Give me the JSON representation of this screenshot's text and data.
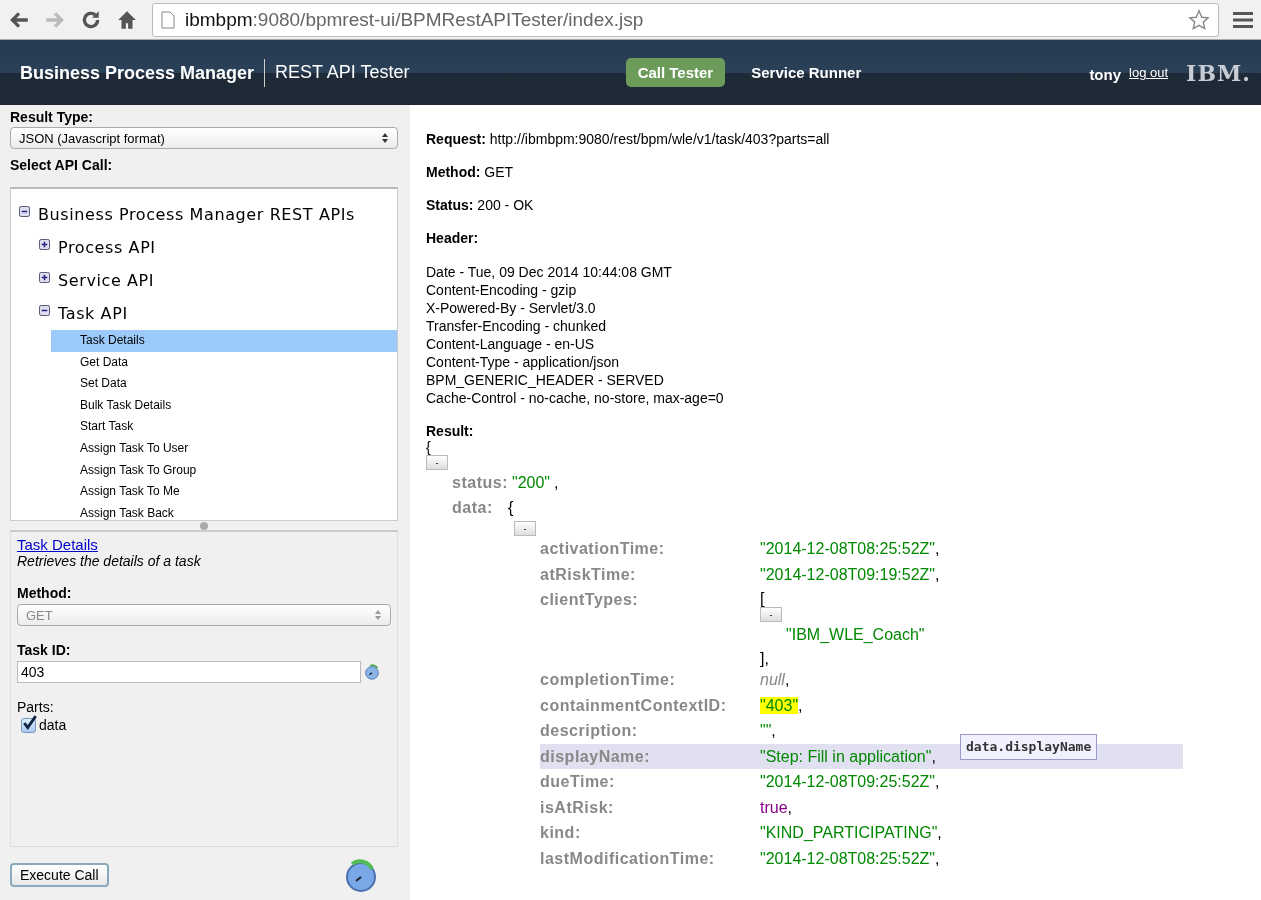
{
  "browser": {
    "url_host": "ibmbpm",
    "url_rest": ":9080/bpmrest-ui/BPMRestAPITester/index.jsp",
    "forward_disabled": true
  },
  "header": {
    "product": "Business Process Manager",
    "app": "REST API Tester",
    "nav": [
      {
        "label": "Call Tester",
        "selected": true
      },
      {
        "label": "Service Runner",
        "selected": false
      }
    ],
    "user": "tony",
    "logout": "log out",
    "logo": "IBM."
  },
  "left": {
    "result_type_label": "Result Type:",
    "result_type": "JSON (Javascript format)",
    "select_label": "Select API Call:",
    "tree": [
      {
        "label": "Business Process Manager REST APIs",
        "expanded": true,
        "children": [
          {
            "label": "Process API",
            "expanded": false
          },
          {
            "label": "Service API",
            "expanded": false
          },
          {
            "label": "Task API",
            "expanded": true,
            "children": [
              {
                "label": "Task Details",
                "selected": true
              },
              {
                "label": "Get Data",
                "selected": false
              },
              {
                "label": "Set Data",
                "selected": false
              },
              {
                "label": "Bulk Task Details",
                "selected": false
              },
              {
                "label": "Start Task",
                "selected": false
              },
              {
                "label": "Assign Task To User",
                "selected": false
              },
              {
                "label": "Assign Task To Group",
                "selected": false
              },
              {
                "label": "Assign Task To Me",
                "selected": false
              },
              {
                "label": "Assign Task Back",
                "selected": false
              }
            ]
          }
        ]
      }
    ],
    "detail": {
      "link": "Task Details",
      "description": "Retrieves the details of a task",
      "method_label": "Method:",
      "method": "GET",
      "method_disabled": true,
      "task_id_label": "Task ID:",
      "task_id": "403",
      "parts_label": "Parts:",
      "parts": [
        {
          "label": "data",
          "checked": true
        }
      ]
    },
    "execute": "Execute Call"
  },
  "response": {
    "fields": [
      {
        "label": "Request:",
        "value": "http://ibmbpm:9080/rest/bpm/wle/v1/task/403?parts=all"
      },
      {
        "label": "Method:",
        "value": "GET"
      },
      {
        "label": "Status:",
        "value": "200 - OK"
      }
    ],
    "header_label": "Header:",
    "headers": [
      "Date - Tue, 09 Dec 2014 10:44:08 GMT",
      "Content-Encoding - gzip",
      "X-Powered-By - Servlet/3.0",
      "Transfer-Encoding - chunked",
      "Content-Language - en-US",
      "Content-Type - application/json",
      "BPM_GENERIC_HEADER - SERVED",
      "Cache-Control - no-cache, no-store, max-age=0"
    ],
    "result_label": "Result:",
    "open": "{",
    "toggle": "-",
    "status_key": "status:",
    "status_value": "\"200\"",
    "status_suffix": ",",
    "data_key": "data:",
    "data_open": "{",
    "rows": [
      {
        "key": "activationTime:",
        "kind": "string",
        "value": "\"2014-12-08T08:25:52Z\"",
        "suffix": ",",
        "hovered": false
      },
      {
        "key": "atRiskTime:",
        "kind": "string",
        "value": "\"2014-12-08T09:19:52Z\"",
        "suffix": ",",
        "hovered": false
      },
      {
        "key": "clientTypes:",
        "kind": "array",
        "open": "[",
        "items": [
          "\"IBM_WLE_Coach\""
        ],
        "close": "]",
        "suffix": ",",
        "hovered": false
      },
      {
        "key": "completionTime:",
        "kind": "null",
        "value": "null",
        "suffix": ",",
        "hovered": false
      },
      {
        "key": "containmentContextID:",
        "kind": "string",
        "value": "\"403\"",
        "suffix": ",",
        "hovered": false,
        "marked": true
      },
      {
        "key": "description:",
        "kind": "string",
        "value": "\"\"",
        "suffix": ",",
        "hovered": false
      },
      {
        "key": "displayName:",
        "kind": "string",
        "value": "\"Step: Fill in application\"",
        "suffix": ",",
        "hovered": true,
        "tooltip": "data.displayName"
      },
      {
        "key": "dueTime:",
        "kind": "string",
        "value": "\"2014-12-08T09:25:52Z\"",
        "suffix": ",",
        "hovered": false
      },
      {
        "key": "isAtRisk:",
        "kind": "boolean",
        "value": "true",
        "suffix": ",",
        "hovered": false
      },
      {
        "key": "kind:",
        "kind": "string",
        "value": "\"KIND_PARTICIPATING\"",
        "suffix": ",",
        "hovered": false
      },
      {
        "key": "lastModificationTime:",
        "kind": "string",
        "value": "\"2014-12-08T08:25:52Z\"",
        "suffix": ",",
        "hovered": false
      }
    ]
  }
}
